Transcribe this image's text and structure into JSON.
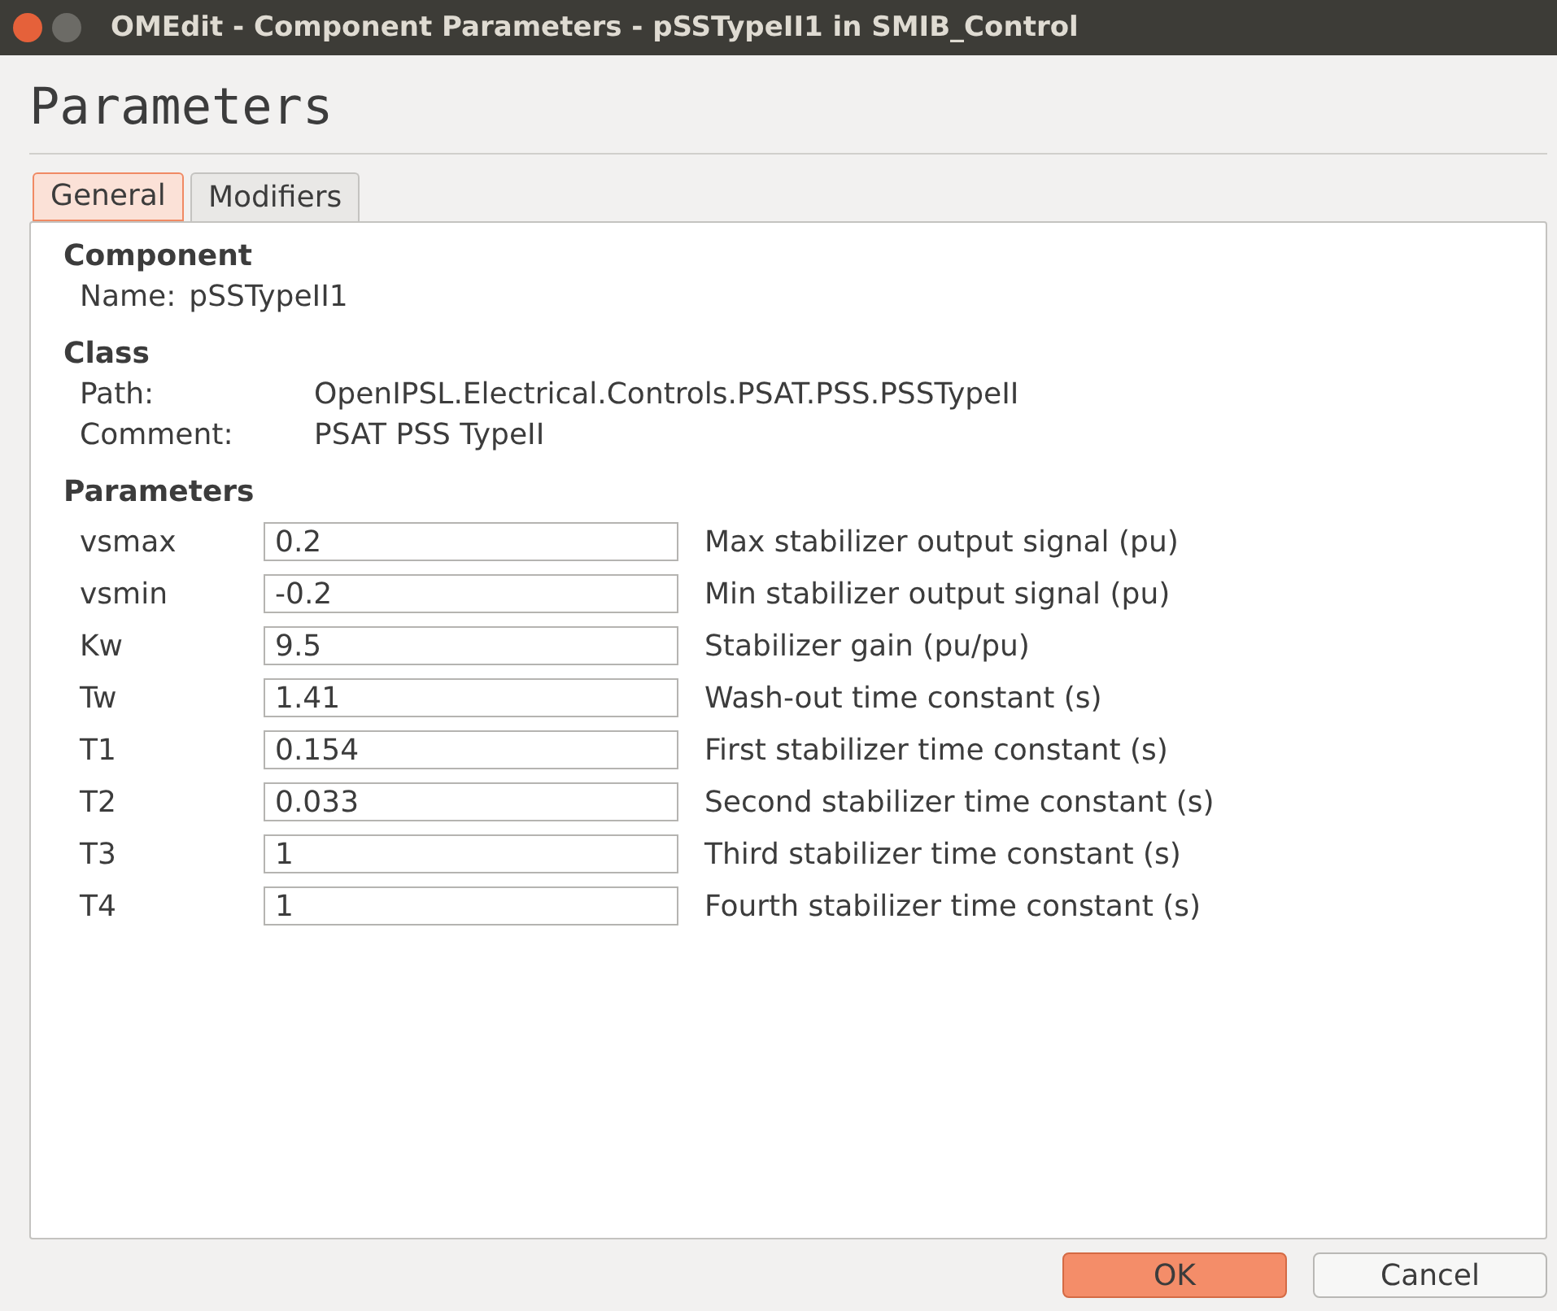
{
  "window": {
    "title": "OMEdit - Component Parameters - pSSTypeII1 in SMIB_Control"
  },
  "heading": "Parameters",
  "tabs": [
    {
      "label": "General",
      "selected": true
    },
    {
      "label": "Modifiers",
      "selected": false
    }
  ],
  "component": {
    "title": "Component",
    "name_label": "Name:",
    "name": "pSSTypeII1"
  },
  "class": {
    "title": "Class",
    "path_label": "Path:",
    "path": "OpenIPSL.Electrical.Controls.PSAT.PSS.PSSTypeII",
    "comment_label": "Comment:",
    "comment": "PSAT PSS TypeII"
  },
  "parameters": {
    "title": "Parameters",
    "rows": [
      {
        "name": "vsmax",
        "value": "0.2",
        "description": "Max stabilizer output signal (pu)"
      },
      {
        "name": "vsmin",
        "value": "-0.2",
        "description": "Min stabilizer output signal (pu)"
      },
      {
        "name": "Kw",
        "value": "9.5",
        "description": "Stabilizer gain (pu/pu)"
      },
      {
        "name": "Tw",
        "value": "1.41",
        "description": "Wash-out time constant (s)"
      },
      {
        "name": "T1",
        "value": "0.154",
        "description": "First stabilizer time constant (s)"
      },
      {
        "name": "T2",
        "value": "0.033",
        "description": "Second stabilizer time constant (s)"
      },
      {
        "name": "T3",
        "value": "1",
        "description": "Third stabilizer time constant (s)"
      },
      {
        "name": "T4",
        "value": "1",
        "description": "Fourth stabilizer time constant (s)"
      }
    ]
  },
  "buttons": [
    {
      "label": "OK",
      "kind": "primary"
    },
    {
      "label": "Cancel",
      "kind": "secondary"
    }
  ]
}
